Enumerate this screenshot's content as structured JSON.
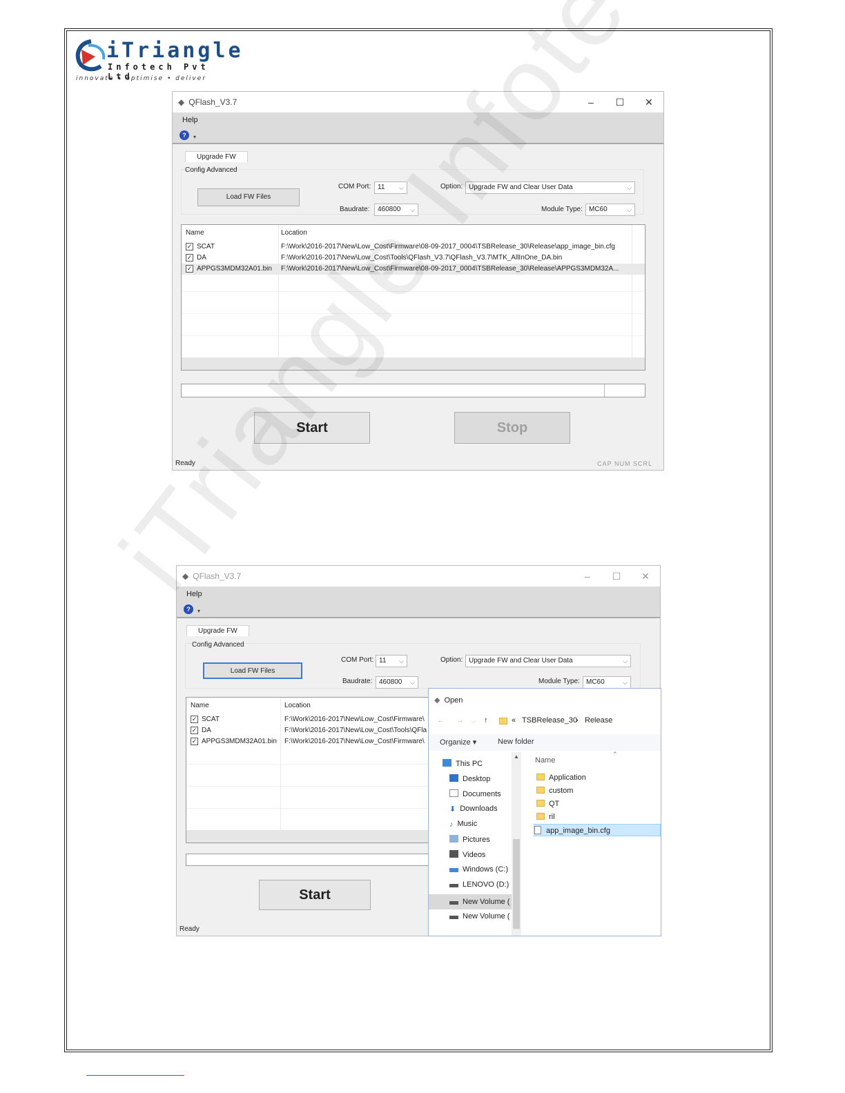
{
  "logo": {
    "brand": "iTriangle",
    "subtitle": "Infotech Pvt Ltd",
    "tagline": "innovate  •  optimise  •  deliver"
  },
  "watermark": "iTriangle Infotech Confidential",
  "screenshot1": {
    "window_title": "QFlash_V3.7",
    "window_controls": {
      "minimize": "–",
      "maximize": "☐",
      "close": "✕"
    },
    "menu": "Help",
    "tab": "Upgrade FW",
    "group": "Config Advanced",
    "load_button": "Load FW Files",
    "com_port_label": "COM Port:",
    "com_port_value": "11",
    "baudrate_label": "Baudrate:",
    "baudrate_value": "460800",
    "option_label": "Option:",
    "option_value": "Upgrade FW and Clear User Data",
    "module_type_label": "Module Type:",
    "module_type_value": "MC60",
    "columns": [
      "Name",
      "Location"
    ],
    "rows": [
      {
        "name": "SCAT",
        "location": "F:\\Work\\2016-2017\\New\\Low_Cost\\Firmware\\08-09-2017_0004\\TSBRelease_30\\Release\\app_image_bin.cfg"
      },
      {
        "name": "DA",
        "location": "F:\\Work\\2016-2017\\New\\Low_Cost\\Tools\\QFlash_V3.7\\QFlash_V3.7\\MTK_AllInOne_DA.bin"
      },
      {
        "name": "APPGS3MDM32A01.bin",
        "location": "F:\\Work\\2016-2017\\New\\Low_Cost\\Firmware\\08-09-2017_0004\\TSBRelease_30\\Release\\APPGS3MDM32A..."
      }
    ],
    "start_button": "Start",
    "stop_button": "Stop",
    "status": "Ready",
    "indicators": "CAP  NUM  SCRL"
  },
  "screenshot2": {
    "window_title": "QFlash_V3.7",
    "window_controls": {
      "minimize": "–",
      "maximize": "☐",
      "close": "✕"
    },
    "menu": "Help",
    "tab": "Upgrade FW",
    "group": "Config Advanced",
    "load_button": "Load FW Files",
    "com_port_label": "COM Port:",
    "com_port_value": "11",
    "baudrate_label": "Baudrate:",
    "baudrate_value": "460800",
    "option_label": "Option:",
    "option_value": "Upgrade FW and Clear User Data",
    "module_type_label": "Module Type:",
    "module_type_value": "MC60",
    "columns": [
      "Name",
      "Location"
    ],
    "rows": [
      {
        "name": "SCAT",
        "location": "F:\\Work\\2016-2017\\New\\Low_Cost\\Firmware\\"
      },
      {
        "name": "DA",
        "location": "F:\\Work\\2016-2017\\New\\Low_Cost\\Tools\\QFla"
      },
      {
        "name": "APPGS3MDM32A01.bin",
        "location": "F:\\Work\\2016-2017\\New\\Low_Cost\\Firmware\\"
      }
    ],
    "start_button": "Start",
    "status": "Ready"
  },
  "open_dialog": {
    "title": "Open",
    "breadcrumb": [
      "«",
      "TSBRelease_30",
      "›",
      "Release"
    ],
    "organize": "Organize ▾",
    "new_folder": "New folder",
    "nav": [
      {
        "label": "This PC",
        "icon": "pc-icon"
      },
      {
        "label": "Desktop",
        "icon": "desktop-icon"
      },
      {
        "label": "Documents",
        "icon": "documents-icon"
      },
      {
        "label": "Downloads",
        "icon": "downloads-icon"
      },
      {
        "label": "Music",
        "icon": "music-icon"
      },
      {
        "label": "Pictures",
        "icon": "pictures-icon"
      },
      {
        "label": "Videos",
        "icon": "videos-icon"
      },
      {
        "label": "Windows (C:)",
        "icon": "drive-icon"
      },
      {
        "label": "LENOVO (D:)",
        "icon": "drive-icon"
      },
      {
        "label": "New Volume (",
        "icon": "drive-icon"
      },
      {
        "label": "New Volume (",
        "icon": "drive-icon"
      }
    ],
    "column_name": "Name",
    "files": [
      {
        "label": "Application",
        "type": "folder"
      },
      {
        "label": "custom",
        "type": "folder"
      },
      {
        "label": "QT",
        "type": "folder"
      },
      {
        "label": "ril",
        "type": "folder"
      },
      {
        "label": "app_image_bin.cfg",
        "type": "file"
      }
    ]
  }
}
